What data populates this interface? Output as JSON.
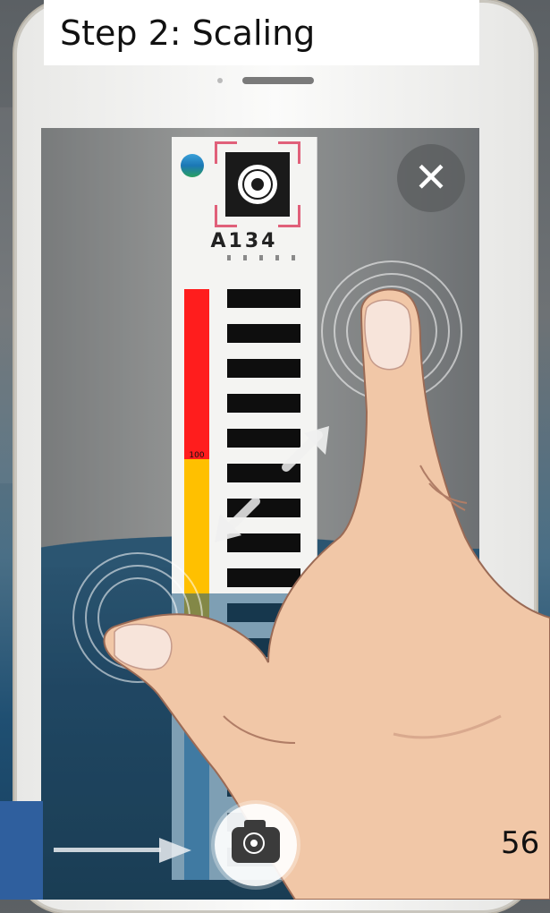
{
  "header": {
    "step_title": "Step 2: Scaling"
  },
  "gauge": {
    "station_id": "A134",
    "threshold_label": "100"
  },
  "buttons": {
    "close_icon": "close-icon",
    "shutter_icon": "camera-icon"
  },
  "gesture": {
    "type": "pinch-to-zoom"
  },
  "footer": {
    "page_number": "56"
  }
}
